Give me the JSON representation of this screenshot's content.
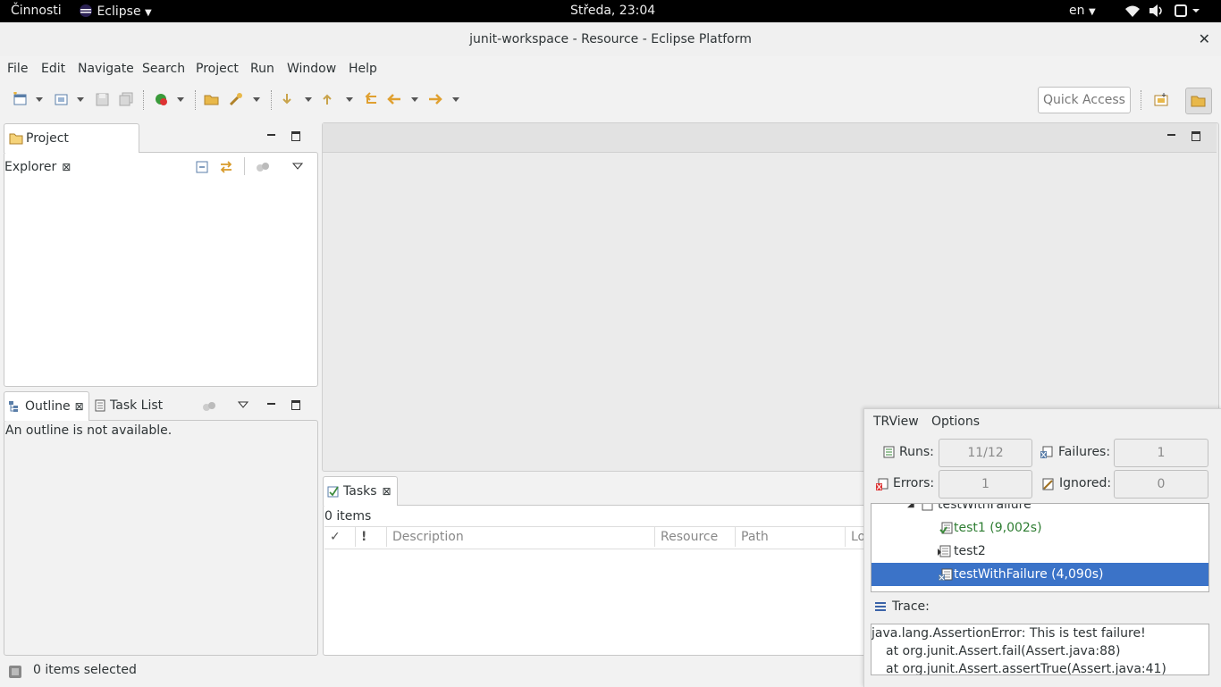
{
  "topbar": {
    "activities": "Činnosti",
    "app_name": "Eclipse",
    "clock": "Středa, 23:04",
    "language": "en"
  },
  "window": {
    "title": "junit-workspace - Resource - Eclipse Platform"
  },
  "menu": [
    "File",
    "Edit",
    "Navigate",
    "Search",
    "Project",
    "Run",
    "Window",
    "Help"
  ],
  "toolbar": {
    "quick_access": "Quick Access"
  },
  "project_explorer": {
    "tab_label": "Project Explorer"
  },
  "outline": {
    "tab_label": "Outline",
    "task_list_label": "Task List",
    "message": "An outline is not available."
  },
  "tasks": {
    "tab_label": "Tasks",
    "count": "0 items",
    "columns": [
      "✓",
      "!",
      "Description",
      "Resource",
      "Path",
      "Lo"
    ]
  },
  "statusbar": {
    "text": "0 items selected"
  },
  "junit": {
    "menu": [
      "TRView",
      "Options"
    ],
    "runs_label": "Runs:",
    "runs_value": "11/12",
    "failures_label": "Failures:",
    "failures_value": "1",
    "errors_label": "Errors:",
    "errors_value": "1",
    "ignored_label": "Ignored:",
    "ignored_value": "0",
    "tree": {
      "parent": "testWithFailure",
      "items": [
        {
          "label": "test1 (9,002s)",
          "status": "passed",
          "color": "#2e7d32"
        },
        {
          "label": "test2",
          "status": "running",
          "color": "#2e3436"
        },
        {
          "label": "testWithFailure (4,090s)",
          "status": "failed",
          "color": "#ffffff"
        }
      ]
    },
    "trace_label": "Trace:",
    "trace_lines": [
      "java.lang.AssertionError: This is test failure!",
      "at org.junit.Assert.fail(Assert.java:88)",
      "at org.junit.Assert.assertTrue(Assert.java:41)"
    ]
  },
  "colors": {
    "selection": "#3b73c8",
    "passed_text": "#2e7d32"
  }
}
